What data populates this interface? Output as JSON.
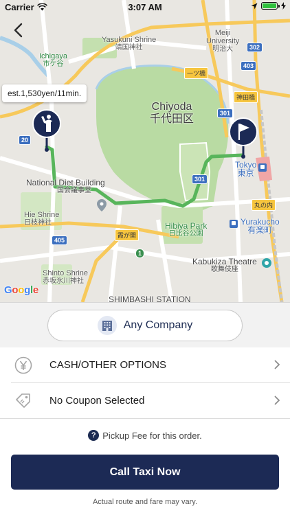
{
  "status_bar": {
    "carrier": "Carrier",
    "time": "3:07 AM"
  },
  "map": {
    "fare_estimate": "est.1,530yen/11min.",
    "labels": {
      "yasukuni_en": "Yasukuni Shrine",
      "yasukuni_ja": "靖国神社",
      "meiji_en": "Meiji",
      "meiji_en2": "University",
      "meiji_ja": "明治大",
      "ichigaya_en": "Ichigaya",
      "ichigaya_ja": "市ケ谷",
      "chiyoda_en": "Chiyoda",
      "chiyoda_ja": "千代田区",
      "hitotsubashi": "一ツ橋",
      "kanda": "神田橋",
      "tokyo_en": "Tokyo",
      "tokyo_ja": "東京",
      "marunouchi": "丸の内",
      "diet_en": "National Diet Building",
      "diet_ja": "国会議事堂",
      "hie_en": "Hie Shrine",
      "hie_ja": "日枝神社",
      "kasumigaseki": "霞が関",
      "hibiya_en": "Hibiya Park",
      "hibiya_ja": "日比谷公園",
      "yurakucho_en": "Yurakucho",
      "yurakucho_ja": "有楽町",
      "kabukiza_en": "Kabukiza Theatre",
      "kabukiza_ja": "歌舞伎座",
      "shinto_en": "Shinto Shrine",
      "shinto_ja": "赤坂氷川神社",
      "shimbashi": "SHIMBASHI STATION"
    },
    "road_badges": {
      "r20": "20",
      "r302": "302",
      "r403": "403",
      "r301a": "301",
      "r301b": "301",
      "r405": "405",
      "r1": "1"
    },
    "google_logo": {
      "g": "G",
      "o1": "o",
      "o2": "o",
      "g2": "g",
      "l": "l",
      "e": "e"
    }
  },
  "company": {
    "label": "Any Company"
  },
  "payment": {
    "label": "CASH/OTHER OPTIONS"
  },
  "coupon": {
    "label": "No Coupon Selected"
  },
  "pickup_fee": {
    "icon": "?",
    "label": "Pickup Fee for this order."
  },
  "call_button": {
    "label": "Call Taxi Now"
  },
  "disclaimer": "Actual route and fare may vary.",
  "colors": {
    "primary": "#1c2a55",
    "route": "#58b55b",
    "park": "#b9dba3"
  }
}
